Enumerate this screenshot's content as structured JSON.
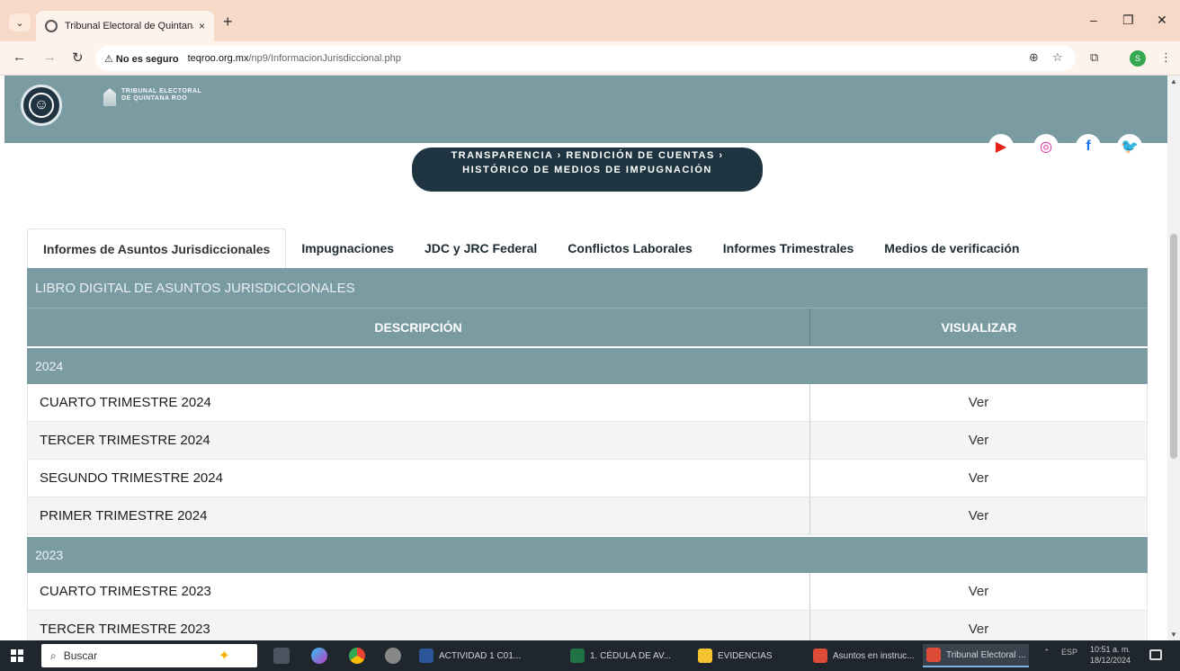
{
  "browser": {
    "tab_title": "Tribunal Electoral de Quintana",
    "new_tab_glyph": "+",
    "close_glyph": "×",
    "minimize_glyph": "–",
    "restore_glyph": "❐",
    "window_close_glyph": "✕",
    "security_label": "⚠ No es seguro",
    "url_host": "teqroo.org.mx",
    "url_path": "/np9/InformacionJurisdiccional.php",
    "profile_initial": "S"
  },
  "site": {
    "logo_line1": "TRIBUNAL ELECTORAL",
    "logo_line2": "DE QUINTANA ROO",
    "breadcrumb_line1": "TRANSPARENCIA ›    RENDICIÓN DE CUENTAS ›",
    "breadcrumb_line2": "HISTÓRICO DE MEDIOS DE IMPUGNACIÓN"
  },
  "social": [
    {
      "name": "youtube",
      "glyph": "▶",
      "color": "#e62117"
    },
    {
      "name": "instagram",
      "glyph": "◎",
      "color": "#d6249f"
    },
    {
      "name": "facebook",
      "glyph": "f",
      "color": "#1877f2"
    },
    {
      "name": "twitter",
      "glyph": "🐦",
      "color": "#1da1f2"
    }
  ],
  "tabs": [
    "Informes de Asuntos Jurisdiccionales",
    "Impugnaciones",
    "JDC y JRC Federal",
    "Conflictos Laborales",
    "Informes Trimestrales",
    "Medios de verificación"
  ],
  "table": {
    "title": "LIBRO DIGITAL DE ASUNTOS JURISDICCIONALES",
    "col_description": "DESCRIPCIÓN",
    "col_view": "VISUALIZAR",
    "view_label": "Ver",
    "groups": [
      {
        "year": "2024",
        "rows": [
          "CUARTO TRIMESTRE 2024",
          "TERCER TRIMESTRE 2024",
          "SEGUNDO TRIMESTRE 2024",
          "PRIMER TRIMESTRE 2024"
        ]
      },
      {
        "year": "2023",
        "rows": [
          "CUARTO TRIMESTRE 2023",
          "TERCER TRIMESTRE 2023"
        ]
      }
    ]
  },
  "taskbar": {
    "search_label": "Buscar",
    "apps": [
      {
        "label": "ACTIVIDAD 1 C01...",
        "color": "#2b579a"
      },
      {
        "label": "1. CÉDULA DE AV...",
        "color": "#217346"
      },
      {
        "label": "EVIDENCIAS",
        "color": "#f4c430"
      },
      {
        "label": "Asuntos en instruc...",
        "color": "#dd4b39"
      },
      {
        "label": "Tribunal Electoral ...",
        "color": "#dd4b39"
      }
    ],
    "lang": "ESP",
    "time": "10:51 a. m.",
    "date": "18/12/2024"
  }
}
